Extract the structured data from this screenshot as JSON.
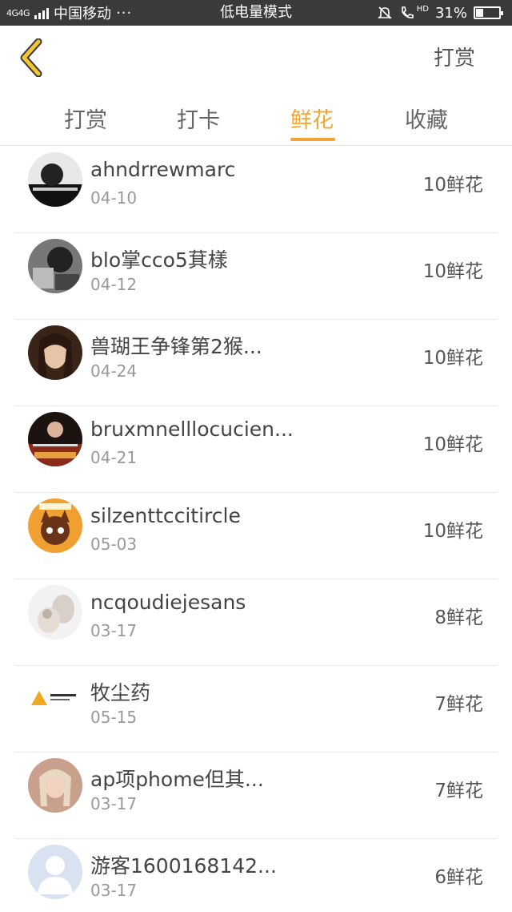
{
  "status_bar": {
    "network": "4G4G",
    "carrier": "中国移动",
    "dots": "···",
    "mode": "低电量模式",
    "hd": "HD",
    "battery_text": "31%",
    "battery_level": 0.31
  },
  "header": {
    "back_icon": "chevron-left-icon",
    "action_label": "打赏"
  },
  "tabs": [
    {
      "label": "打赏",
      "active": false
    },
    {
      "label": "打卡",
      "active": false
    },
    {
      "label": "鲜花",
      "active": true
    },
    {
      "label": "收藏",
      "active": false
    }
  ],
  "colors": {
    "accent": "#f3a533",
    "back_icon": "#f2c531",
    "status_bar_bg": "#3a3a3a",
    "divider": "#e8e8e8"
  },
  "entries": [
    {
      "name": "ahndrrewmarc",
      "date": "04-10",
      "amount": "10鲜花"
    },
    {
      "name": "blo掌cco5萁樣",
      "date": "04-12",
      "amount": "10鲜花"
    },
    {
      "name": "兽瑚王争锋第2猴...",
      "date": "04-24",
      "amount": "10鲜花"
    },
    {
      "name": "bruxmnelllocucien...",
      "date": "04-21",
      "amount": "10鲜花"
    },
    {
      "name": "silzenttccitircle",
      "date": "05-03",
      "amount": "10鲜花"
    },
    {
      "name": "ncqoudiejesans",
      "date": "03-17",
      "amount": "8鲜花"
    },
    {
      "name": "牧尘药",
      "date": "05-15",
      "amount": "7鲜花"
    },
    {
      "name": "ap项phome但其...",
      "date": "03-17",
      "amount": "7鲜花"
    },
    {
      "name": "游客1600168142...",
      "date": "03-17",
      "amount": "6鲜花"
    }
  ]
}
